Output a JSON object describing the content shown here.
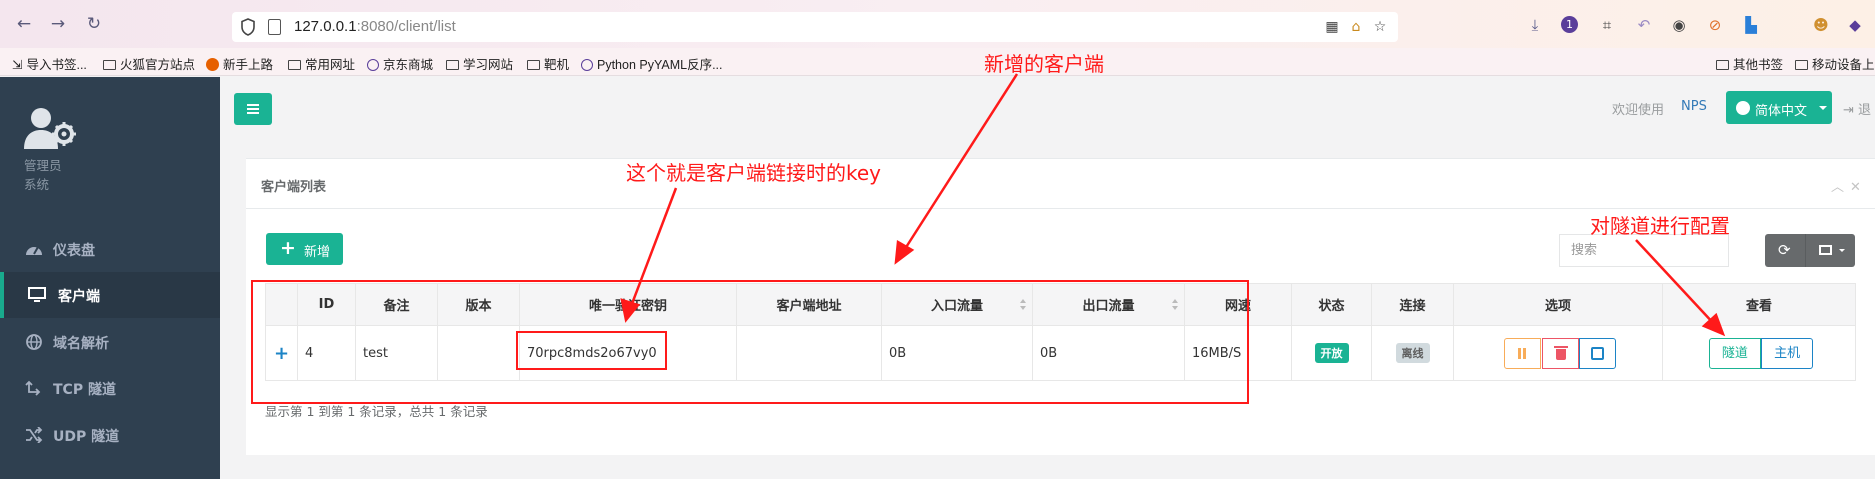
{
  "browser": {
    "url_host": "127.0.0.1",
    "url_rest": ":8080/client/list",
    "bookmarks": [
      "导入书签...",
      "火狐官方站点",
      "新手上路",
      "常用网址",
      "京东商城",
      "学习网站",
      "靶机",
      "Python PyYAML反序...",
      "其他书签",
      "移动设备上的"
    ]
  },
  "sidebar": {
    "admin_line1": "管理员",
    "admin_line2": "系统",
    "items": [
      {
        "label": "仪表盘",
        "icon": "dashboard-icon"
      },
      {
        "label": "客户端",
        "icon": "monitor-icon"
      },
      {
        "label": "域名解析",
        "icon": "globe-icon"
      },
      {
        "label": "TCP 隧道",
        "icon": "tcp-tunnel-icon"
      },
      {
        "label": "UDP 隧道",
        "icon": "udp-tunnel-icon"
      }
    ]
  },
  "topbar": {
    "welcome": "欢迎使用",
    "nps": "NPS",
    "language": "简体中文",
    "logout": "退"
  },
  "panel": {
    "title": "客户端列表",
    "add_label": "新增",
    "search_placeholder": "搜索"
  },
  "table": {
    "headers": [
      "ID",
      "备注",
      "版本",
      "唯一验证密钥",
      "客户端地址",
      "入口流量",
      "出口流量",
      "网速",
      "状态",
      "连接",
      "选项",
      "查看"
    ],
    "row": {
      "expand": "+",
      "id": "4",
      "remark": "test",
      "version": "",
      "vkey": "70rpc8mds2o67vy0",
      "address": "",
      "inlet": "0B",
      "export": "0B",
      "speed": "16MB/S",
      "status": "开放",
      "connect": "离线",
      "view_tunnel": "隧道",
      "view_host": "主机"
    },
    "pager_text": "显示第 1 到第 1 条记录，总共 1 条记录"
  },
  "annotations": {
    "new_client": "新增的客户端",
    "vkey_note": "这个就是客户端链接时的key",
    "tunnel_note": "对隧道进行配置",
    "color": "#ff1a1a"
  }
}
